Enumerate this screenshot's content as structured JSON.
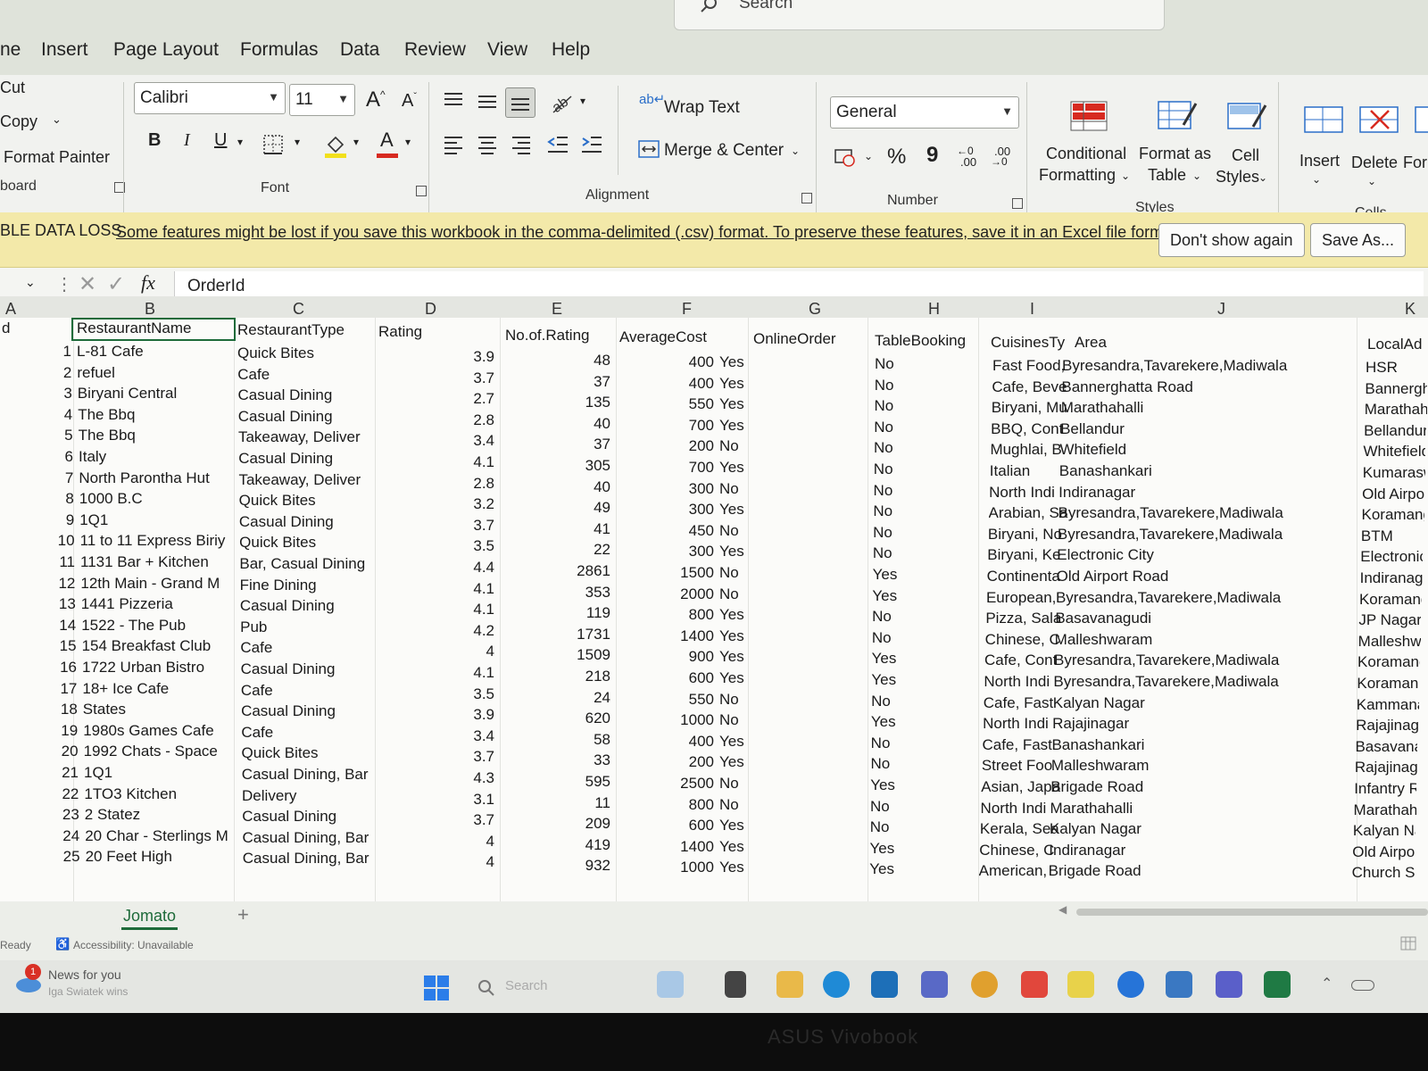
{
  "search": {
    "label": "Search"
  },
  "menu": {
    "tabs": [
      "ne",
      "Insert",
      "Page Layout",
      "Formulas",
      "Data",
      "Review",
      "View",
      "Help"
    ]
  },
  "ribbon": {
    "clipboard": {
      "cut": "Cut",
      "copy": "Copy",
      "format_painter": "Format Painter",
      "group": "board"
    },
    "font": {
      "name": "Calibri",
      "size": "11",
      "group": "Font",
      "grow": "A",
      "shrink": "A",
      "bold": "B",
      "italic": "I",
      "underline": "U",
      "font_color": "A"
    },
    "alignment": {
      "wrap": "Wrap Text",
      "merge": "Merge & Center",
      "group": "Alignment"
    },
    "number": {
      "format": "General",
      "percent": "%",
      "comma": "9",
      "inc": ".00",
      "dec": ".00",
      "group": "Number"
    },
    "styles": {
      "cond1": "Conditional",
      "cond2": "Formatting",
      "fmt1": "Format as",
      "fmt2": "Table",
      "cell1": "Cell",
      "cell2": "Styles",
      "group": "Styles"
    },
    "cells": {
      "insert": "Insert",
      "delete": "Delete",
      "format": "For",
      "group": "Cells"
    }
  },
  "warning": {
    "title": "BLE DATA LOSS",
    "message": "Some features might be lost if you save this workbook in the comma-delimited (.csv) format. To preserve these features, save it in an Excel file format.",
    "dont_show": "Don't show again",
    "save_as": "Save As..."
  },
  "formula_bar": {
    "fx": "fx",
    "value": "OrderId"
  },
  "columns": [
    "A",
    "B",
    "C",
    "D",
    "E",
    "F",
    "G",
    "H",
    "I",
    "J",
    "K"
  ],
  "header_row": {
    "a": "d",
    "b": "RestaurantName",
    "c": "RestaurantType",
    "d": "Rating",
    "e": "No.of.Rating",
    "f": "AverageCost",
    "g": "OnlineOrder",
    "h": "TableBooking",
    "i": "CuisinesTy",
    "j": "Area",
    "k": "LocalAd"
  },
  "rows": [
    {
      "id": "1",
      "name": "L-81 Cafe",
      "type": "Quick Bites",
      "rating": "3.9",
      "count": "48",
      "cost": "400",
      "online": "Yes",
      "booking": "No",
      "cuisine": "Fast Food,",
      "area": "Byresandra,Tavarekere,Madiwala",
      "local": "HSR"
    },
    {
      "id": "2",
      "name": "refuel",
      "type": "Cafe",
      "rating": "3.7",
      "count": "37",
      "cost": "400",
      "online": "Yes",
      "booking": "No",
      "cuisine": "Cafe, Beve",
      "area": "Bannerghatta Road",
      "local": "Bannergh"
    },
    {
      "id": "3",
      "name": "Biryani Central",
      "type": "Casual Dining",
      "rating": "2.7",
      "count": "135",
      "cost": "550",
      "online": "Yes",
      "booking": "No",
      "cuisine": "Biryani, Mu",
      "area": "Marathahalli",
      "local": "Marathah"
    },
    {
      "id": "4",
      "name": "The Bbq",
      "type": "Casual Dining",
      "rating": "2.8",
      "count": "40",
      "cost": "700",
      "online": "Yes",
      "booking": "No",
      "cuisine": "BBQ, Cont",
      "area": "Bellandur",
      "local": "Bellandur"
    },
    {
      "id": "5",
      "name": "The Bbq",
      "type": "Takeaway, Deliver",
      "rating": "3.4",
      "count": "37",
      "cost": "200",
      "online": "No",
      "booking": "No",
      "cuisine": "Mughlai, B",
      "area": "Whitefield",
      "local": "Whitefield"
    },
    {
      "id": "6",
      "name": "Italy",
      "type": "Casual Dining",
      "rating": "4.1",
      "count": "305",
      "cost": "700",
      "online": "Yes",
      "booking": "No",
      "cuisine": "Italian",
      "area": "Banashankari",
      "local": "Kumarasw"
    },
    {
      "id": "7",
      "name": "North Parontha Hut",
      "type": "Takeaway, Deliver",
      "rating": "2.8",
      "count": "40",
      "cost": "300",
      "online": "No",
      "booking": "No",
      "cuisine": "North Indi",
      "area": "Indiranagar",
      "local": "Old Airpor"
    },
    {
      "id": "8",
      "name": "1000 B.C",
      "type": "Quick Bites",
      "rating": "3.2",
      "count": "49",
      "cost": "300",
      "online": "Yes",
      "booking": "No",
      "cuisine": "Arabian, Sa",
      "area": "Byresandra,Tavarekere,Madiwala",
      "local": "Koramang"
    },
    {
      "id": "9",
      "name": "1Q1",
      "type": "Casual Dining",
      "rating": "3.7",
      "count": "41",
      "cost": "450",
      "online": "No",
      "booking": "No",
      "cuisine": "Biryani, No",
      "area": "Byresandra,Tavarekere,Madiwala",
      "local": "BTM"
    },
    {
      "id": "10",
      "name": "11 to 11 Express Biriy",
      "type": "Quick Bites",
      "rating": "3.5",
      "count": "22",
      "cost": "300",
      "online": "Yes",
      "booking": "No",
      "cuisine": "Biryani, Ke",
      "area": "Electronic City",
      "local": "Electronic"
    },
    {
      "id": "11",
      "name": "1131 Bar + Kitchen",
      "type": "Bar, Casual Dining",
      "rating": "4.4",
      "count": "2861",
      "cost": "1500",
      "online": "No",
      "booking": "Yes",
      "cuisine": "Continenta",
      "area": "Old Airport Road",
      "local": "Indiranaga"
    },
    {
      "id": "12",
      "name": "12th Main - Grand M",
      "type": "Fine Dining",
      "rating": "4.1",
      "count": "353",
      "cost": "2000",
      "online": "No",
      "booking": "Yes",
      "cuisine": "European,",
      "area": "Byresandra,Tavarekere,Madiwala",
      "local": "Koramang"
    },
    {
      "id": "13",
      "name": "1441 Pizzeria",
      "type": "Casual Dining",
      "rating": "4.1",
      "count": "119",
      "cost": "800",
      "online": "Yes",
      "booking": "No",
      "cuisine": "Pizza, Sala",
      "area": "Basavanagudi",
      "local": "JP Nagar"
    },
    {
      "id": "14",
      "name": "1522 - The Pub",
      "type": "Pub",
      "rating": "4.2",
      "count": "1731",
      "cost": "1400",
      "online": "Yes",
      "booking": "No",
      "cuisine": "Chinese, C",
      "area": "Malleshwaram",
      "local": "Malleshwa"
    },
    {
      "id": "15",
      "name": "154 Breakfast Club",
      "type": "Cafe",
      "rating": "4",
      "count": "1509",
      "cost": "900",
      "online": "Yes",
      "booking": "Yes",
      "cuisine": "Cafe, Cont",
      "area": "Byresandra,Tavarekere,Madiwala",
      "local": "Koramang"
    },
    {
      "id": "16",
      "name": "1722 Urban Bistro",
      "type": "Casual Dining",
      "rating": "4.1",
      "count": "218",
      "cost": "600",
      "online": "Yes",
      "booking": "Yes",
      "cuisine": "North Indi",
      "area": "Byresandra,Tavarekere,Madiwala",
      "local": "Koramang"
    },
    {
      "id": "17",
      "name": "18+ Ice Cafe",
      "type": "Cafe",
      "rating": "3.5",
      "count": "24",
      "cost": "550",
      "online": "No",
      "booking": "No",
      "cuisine": "Cafe, Fast",
      "area": "Kalyan Nagar",
      "local": "Kammanal"
    },
    {
      "id": "18",
      "name": "States",
      "type": "Casual Dining",
      "rating": "3.9",
      "count": "620",
      "cost": "1000",
      "online": "No",
      "booking": "Yes",
      "cuisine": "North Indi",
      "area": "Rajajinagar",
      "local": "Rajajinaga"
    },
    {
      "id": "19",
      "name": "1980s Games Cafe",
      "type": "Cafe",
      "rating": "3.4",
      "count": "58",
      "cost": "400",
      "online": "Yes",
      "booking": "No",
      "cuisine": "Cafe, Fast",
      "area": "Banashankari",
      "local": "Basavanag"
    },
    {
      "id": "20",
      "name": "1992 Chats - Space",
      "type": "Quick Bites",
      "rating": "3.7",
      "count": "33",
      "cost": "200",
      "online": "Yes",
      "booking": "No",
      "cuisine": "Street Foo",
      "area": "Malleshwaram",
      "local": "Rajajinaga"
    },
    {
      "id": "21",
      "name": "1Q1",
      "type": "Casual Dining, Bar",
      "rating": "4.3",
      "count": "595",
      "cost": "2500",
      "online": "No",
      "booking": "Yes",
      "cuisine": "Asian, Japa",
      "area": "Brigade Road",
      "local": "Infantry Ro"
    },
    {
      "id": "22",
      "name": "1TO3 Kitchen",
      "type": "Delivery",
      "rating": "3.1",
      "count": "11",
      "cost": "800",
      "online": "No",
      "booking": "No",
      "cuisine": "North Indi",
      "area": "Marathahalli",
      "local": "Marathah"
    },
    {
      "id": "23",
      "name": "2 Statez",
      "type": "Casual Dining",
      "rating": "3.7",
      "count": "209",
      "cost": "600",
      "online": "Yes",
      "booking": "No",
      "cuisine": "Kerala, Sea",
      "area": "Kalyan Nagar",
      "local": "Kalyan Na"
    },
    {
      "id": "24",
      "name": "20 Char - Sterlings M",
      "type": "Casual Dining, Bar",
      "rating": "4",
      "count": "419",
      "cost": "1400",
      "online": "Yes",
      "booking": "Yes",
      "cuisine": "Chinese, C",
      "area": "Indiranagar",
      "local": "Old Airpor"
    },
    {
      "id": "25",
      "name": "20 Feet High",
      "type": "Casual Dining, Bar",
      "rating": "4",
      "count": "932",
      "cost": "1000",
      "online": "Yes",
      "booking": "Yes",
      "cuisine": "American,",
      "area": "Brigade Road",
      "local": "Church Str"
    }
  ],
  "sheet": {
    "tab": "Jomato",
    "add": "+"
  },
  "status": {
    "ready": "Ready",
    "accessibility": "Accessibility: Unavailable"
  },
  "taskbar": {
    "news_title": "News for you",
    "news_sub": "Iga Swiatek wins",
    "news_badge": "1",
    "search": "Search"
  },
  "bezel": {
    "brand": "ASUS Vivobook"
  }
}
